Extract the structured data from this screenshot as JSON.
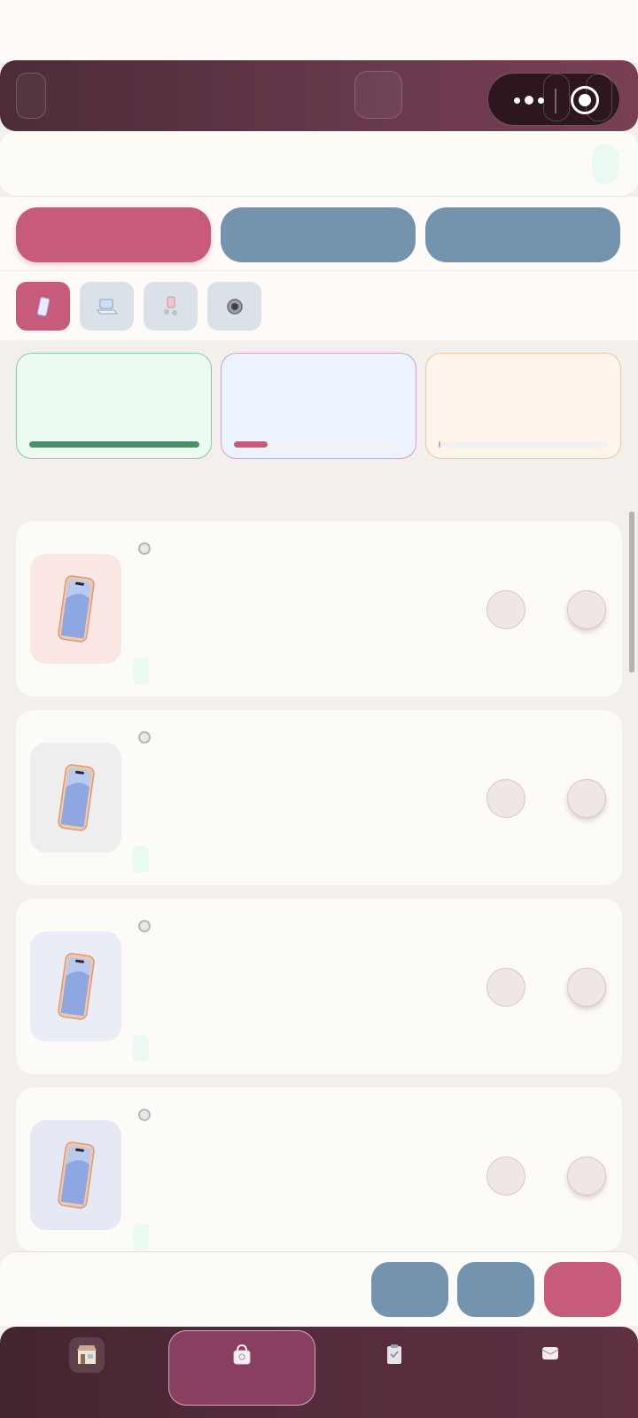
{
  "header": {
    "back_icon": "back-icon",
    "center_icon": "home-icon",
    "capsule_more_icon": "more-dots-icon",
    "capsule_close_icon": "target-close-icon"
  },
  "search": {
    "placeholder": ""
  },
  "tabs": [
    {
      "label": "",
      "active": true
    },
    {
      "label": "",
      "active": false
    },
    {
      "label": "",
      "active": false
    }
  ],
  "categories": [
    {
      "icon": "phone-icon",
      "active": true
    },
    {
      "icon": "laptop-icon",
      "active": false
    },
    {
      "icon": "accessories-icon",
      "active": false
    },
    {
      "icon": "watch-icon",
      "active": false
    }
  ],
  "stats": [
    {
      "label": "",
      "progress": 1.0
    },
    {
      "label": "",
      "progress": 0.2
    },
    {
      "label": "",
      "progress": 0.01
    }
  ],
  "products": [
    {
      "icon": "phone-product-icon",
      "thumb_color": "#fae7e3",
      "badge_icon": "badge-icon"
    },
    {
      "icon": "phone-product-icon",
      "thumb_color": "#efeeee",
      "badge_icon": "badge-icon"
    },
    {
      "icon": "phone-product-icon",
      "thumb_color": "#eaecf6",
      "badge_icon": "badge-icon"
    },
    {
      "icon": "phone-product-icon",
      "thumb_color": "#e6e9f3",
      "badge_icon": "badge-icon"
    }
  ],
  "actions": [
    {
      "label": ""
    },
    {
      "label": ""
    },
    {
      "label": ""
    }
  ],
  "tabbar": [
    {
      "icon": "store-icon",
      "active": false
    },
    {
      "icon": "shopping-bag-icon",
      "active": true
    },
    {
      "icon": "clipboard-icon",
      "active": false
    },
    {
      "icon": "wallet-icon",
      "active": false
    }
  ],
  "colors": {
    "accent": "#c65b7b",
    "secondary": "#7493ad",
    "header": "#5a3242"
  }
}
